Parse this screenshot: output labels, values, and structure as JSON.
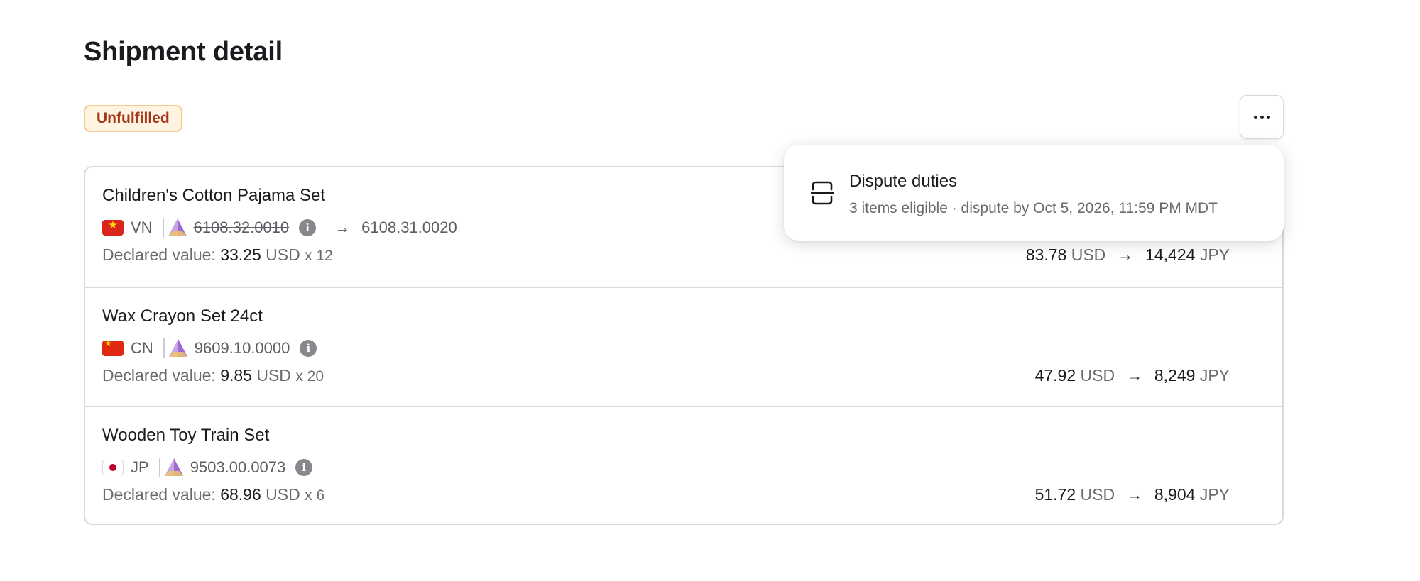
{
  "page": {
    "title": "Shipment detail"
  },
  "status_badge": {
    "label": "Unfulfilled"
  },
  "more_button": {
    "icon": "more-horizontal-icon"
  },
  "menu": {
    "items": [
      {
        "icon": "dispute-icon",
        "title": "Dispute duties",
        "subtitle": "3 items eligible · dispute by Oct 5, 2026, 11:59 PM MDT"
      }
    ]
  },
  "items": [
    {
      "name": "Children's Cotton Pajama Set",
      "country": "VN",
      "original_code": "6108.32.0010",
      "new_code": "6108.31.0020",
      "declared_label": "Declared value:",
      "declared_value": "33.25",
      "declared_currency": "USD",
      "quantity": "x 12",
      "duty_usd": "83.78",
      "duty_usd_currency": "USD",
      "duty_local": "14,424",
      "duty_local_currency": "JPY"
    },
    {
      "name": "Wax Crayon Set 24ct",
      "country": "CN",
      "code": "9609.10.0000",
      "declared_label": "Declared value:",
      "declared_value": "9.85",
      "declared_currency": "USD",
      "quantity": "x 20",
      "duty_usd": "47.92",
      "duty_usd_currency": "USD",
      "duty_local": "8,249",
      "duty_local_currency": "JPY"
    },
    {
      "name": "Wooden Toy Train Set",
      "country": "JP",
      "code": "9503.00.0073",
      "declared_label": "Declared value:",
      "declared_value": "68.96",
      "declared_currency": "USD",
      "quantity": "x 6",
      "duty_usd": "51.72",
      "duty_usd_currency": "USD",
      "duty_local": "8,904",
      "duty_local_currency": "JPY"
    }
  ],
  "colors": {
    "badge_bg": "#fff3e1",
    "badge_text": "#a3361b",
    "border": "#d9d9dd"
  }
}
